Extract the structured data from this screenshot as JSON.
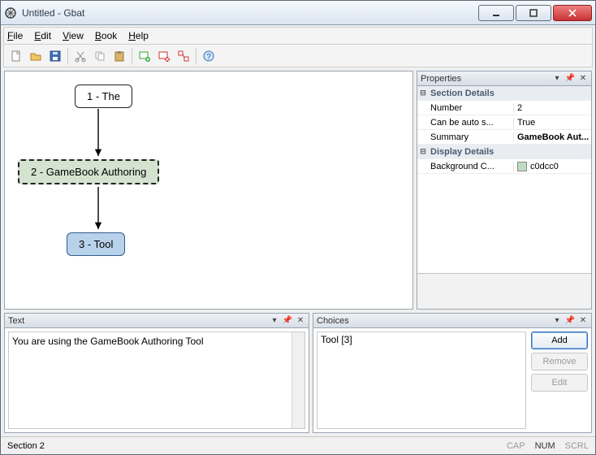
{
  "window": {
    "title": "Untitled - Gbat"
  },
  "menus": {
    "file": "File",
    "edit": "Edit",
    "view": "View",
    "book": "Book",
    "help": "Help"
  },
  "canvas": {
    "node1": "1 - The",
    "node2": "2 - GameBook Authoring",
    "node3": "3 - Tool"
  },
  "panels": {
    "properties": {
      "title": "Properties",
      "cat1": "Section Details",
      "k_number": "Number",
      "v_number": "2",
      "k_auto": "Can be auto s...",
      "v_auto": "True",
      "k_summary": "Summary",
      "v_summary": "GameBook Aut...",
      "cat2": "Display Details",
      "k_bg": "Background C...",
      "v_bg": "c0dcc0"
    },
    "text": {
      "title": "Text",
      "content": "You are using the GameBook Authoring Tool"
    },
    "choices": {
      "title": "Choices",
      "item0": "Tool [3]",
      "add": "Add",
      "remove": "Remove",
      "edit": "Edit"
    }
  },
  "status": {
    "left": "Section 2",
    "cap": "CAP",
    "num": "NUM",
    "scrl": "SCRL"
  },
  "colors": {
    "swatch_bg": "#c0dcc0"
  }
}
